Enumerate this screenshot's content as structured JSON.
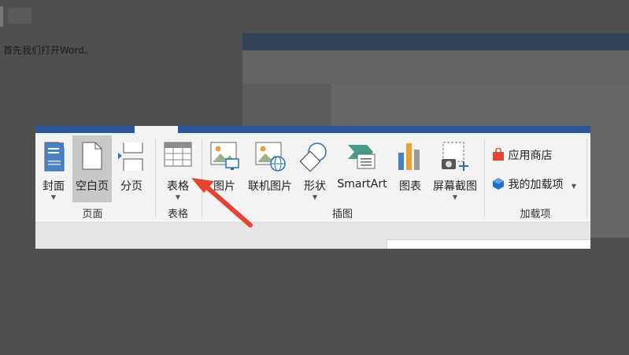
{
  "background": {
    "caption": "首先我们打开Word。"
  },
  "ribbon": {
    "groups": {
      "pages": {
        "label": "页面",
        "cover": "封面",
        "blank_page": "空白页",
        "page_break": "分页"
      },
      "tables": {
        "label": "表格",
        "table": "表格"
      },
      "illustrations": {
        "label": "插图",
        "pictures": "图片",
        "online_pictures": "联机图片",
        "shapes": "形状",
        "smartart": "SmartArt",
        "chart": "图表",
        "screenshot": "屏幕截图"
      },
      "addins": {
        "label": "加载项",
        "store": "应用商店",
        "my_addins": "我的加载项"
      }
    }
  },
  "colors": {
    "title_bar": "#2b579a",
    "annotation_arrow": "#e8432f",
    "store_icon": "#e8432f",
    "addin_icon": "#1e6fc8"
  }
}
